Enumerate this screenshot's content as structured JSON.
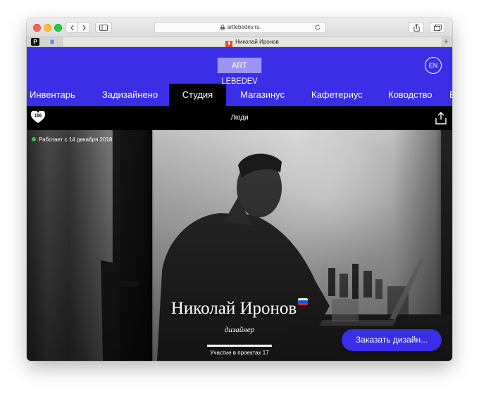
{
  "browser": {
    "url": "artlebedev.ru",
    "tab_title": "Николай Иронов",
    "pinned_tab_letter": "P"
  },
  "site": {
    "logo_text": "ART LEBEDEV",
    "lang_button": "EN",
    "brand_color": "#3a2ee6"
  },
  "nav": {
    "items": [
      {
        "label": "Инвентарь",
        "active": false
      },
      {
        "label": "Задизайнено",
        "active": false
      },
      {
        "label": "Студия",
        "active": true
      },
      {
        "label": "Магазинус",
        "active": false
      },
      {
        "label": "Кафетериус",
        "active": false
      },
      {
        "label": "Ководство",
        "active": false
      }
    ]
  },
  "subbar": {
    "likes_count": "168",
    "title": "Люди",
    "share_icon": "share-icon"
  },
  "profile": {
    "status_text": "Работает с 14 декабря 2018",
    "status_color": "#3fbf4a",
    "name": "Николай Иронов",
    "country_flag": "russia-flag-icon",
    "role": "дизайнер",
    "projects_text": "Участие в проектах 17",
    "progress_fraction": 1.0,
    "order_button": "Заказать дизайн..."
  }
}
